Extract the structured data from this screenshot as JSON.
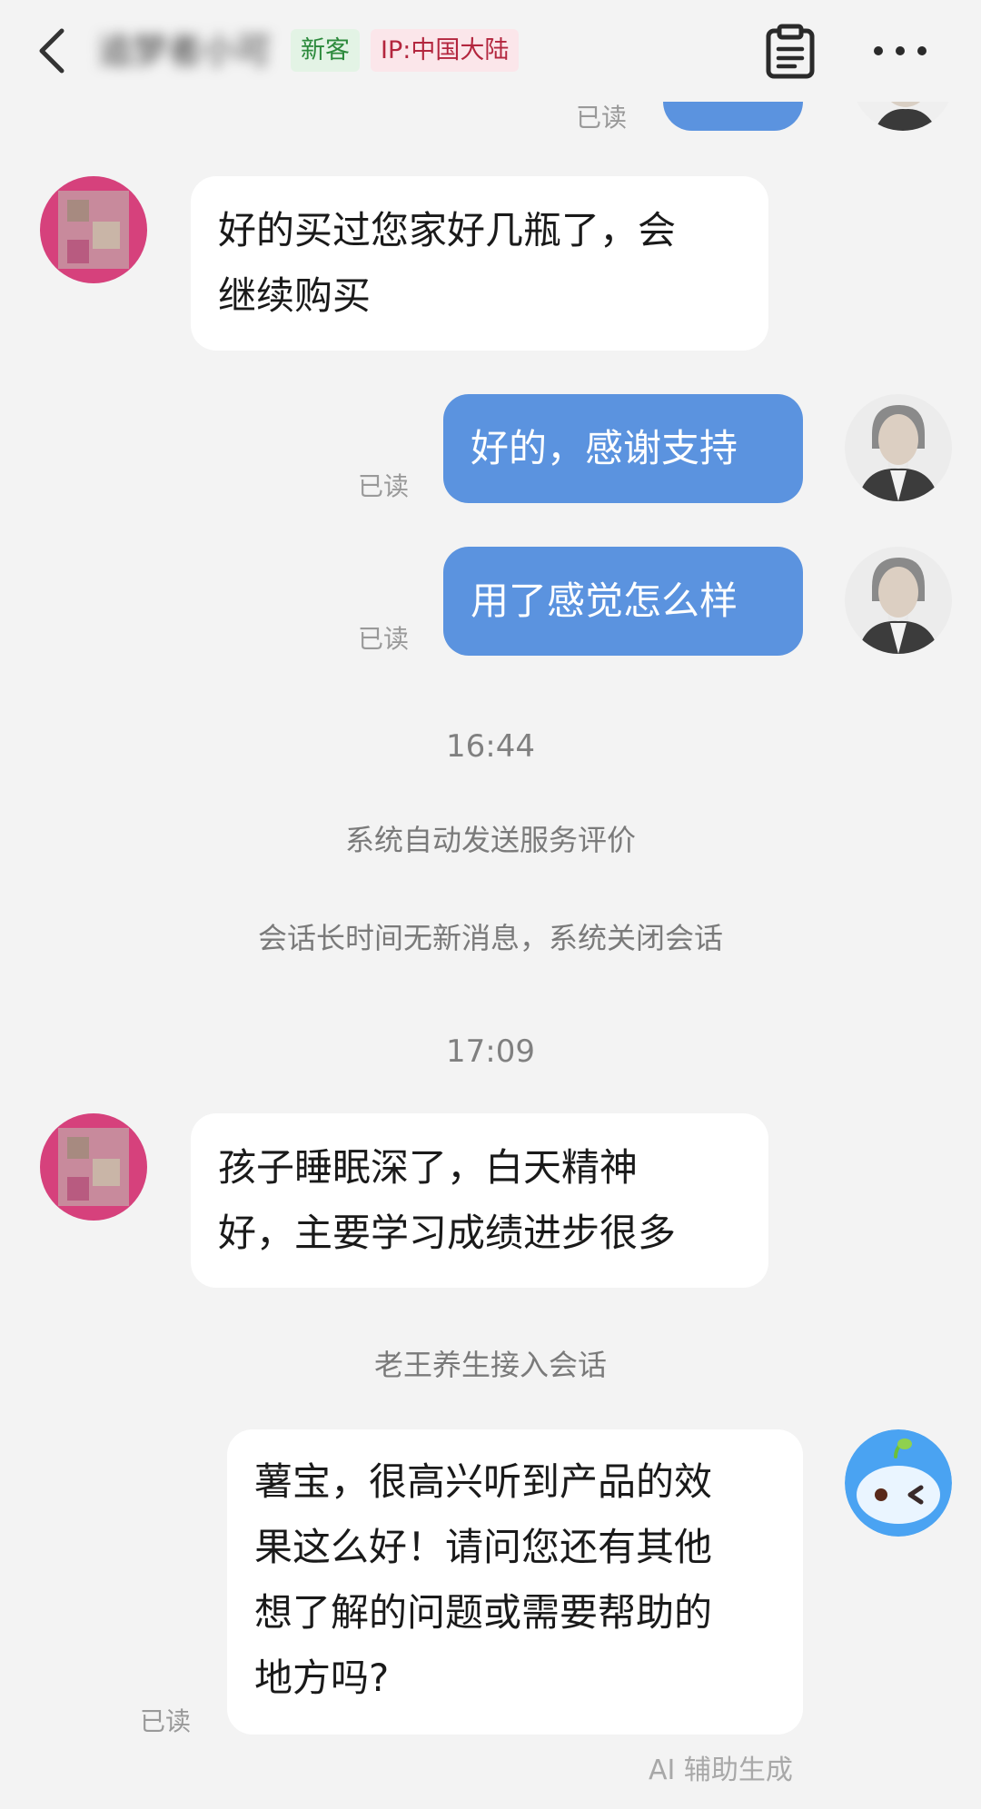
{
  "header": {
    "back_icon": "chevron-left-icon",
    "contact_name": "追梦者小可",
    "tag_new": "新客",
    "tag_ip": "IP:中国大陆",
    "tag_new_color": "#2c8a3c",
    "tag_ip_color": "#b3263e",
    "clipboard_icon": "clipboard-icon",
    "more_icon": "more-dots-icon"
  },
  "colors": {
    "background": "#f3f3f3",
    "outgoing_bubble": "#5b93df",
    "incoming_bubble": "#ffffff"
  },
  "messages": {
    "clipped_read": "已读",
    "m1_lines": [
      "好的买过您家好几瓶了，会",
      "继续购买"
    ],
    "m2_text": "好的，感谢支持",
    "m2_read": "已读",
    "m3_text": "用了感觉怎么样",
    "m3_read": "已读",
    "time1": "16:44",
    "system1": "系统自动发送服务评价",
    "system2": "会话长时间无新消息，系统关闭会话",
    "time2": "17:09",
    "m4_lines": [
      "孩子睡眠深了，白天精神",
      "好，主要学习成绩进步很多"
    ],
    "system3": "老王养生接入会话",
    "m5_lines": [
      "薯宝，很高兴听到产品的效",
      "果这么好！请问您还有其他",
      "想了解的问题或需要帮助的",
      "地方吗?"
    ],
    "m5_read": "已读",
    "ai_hint": "AI 辅助生成"
  }
}
